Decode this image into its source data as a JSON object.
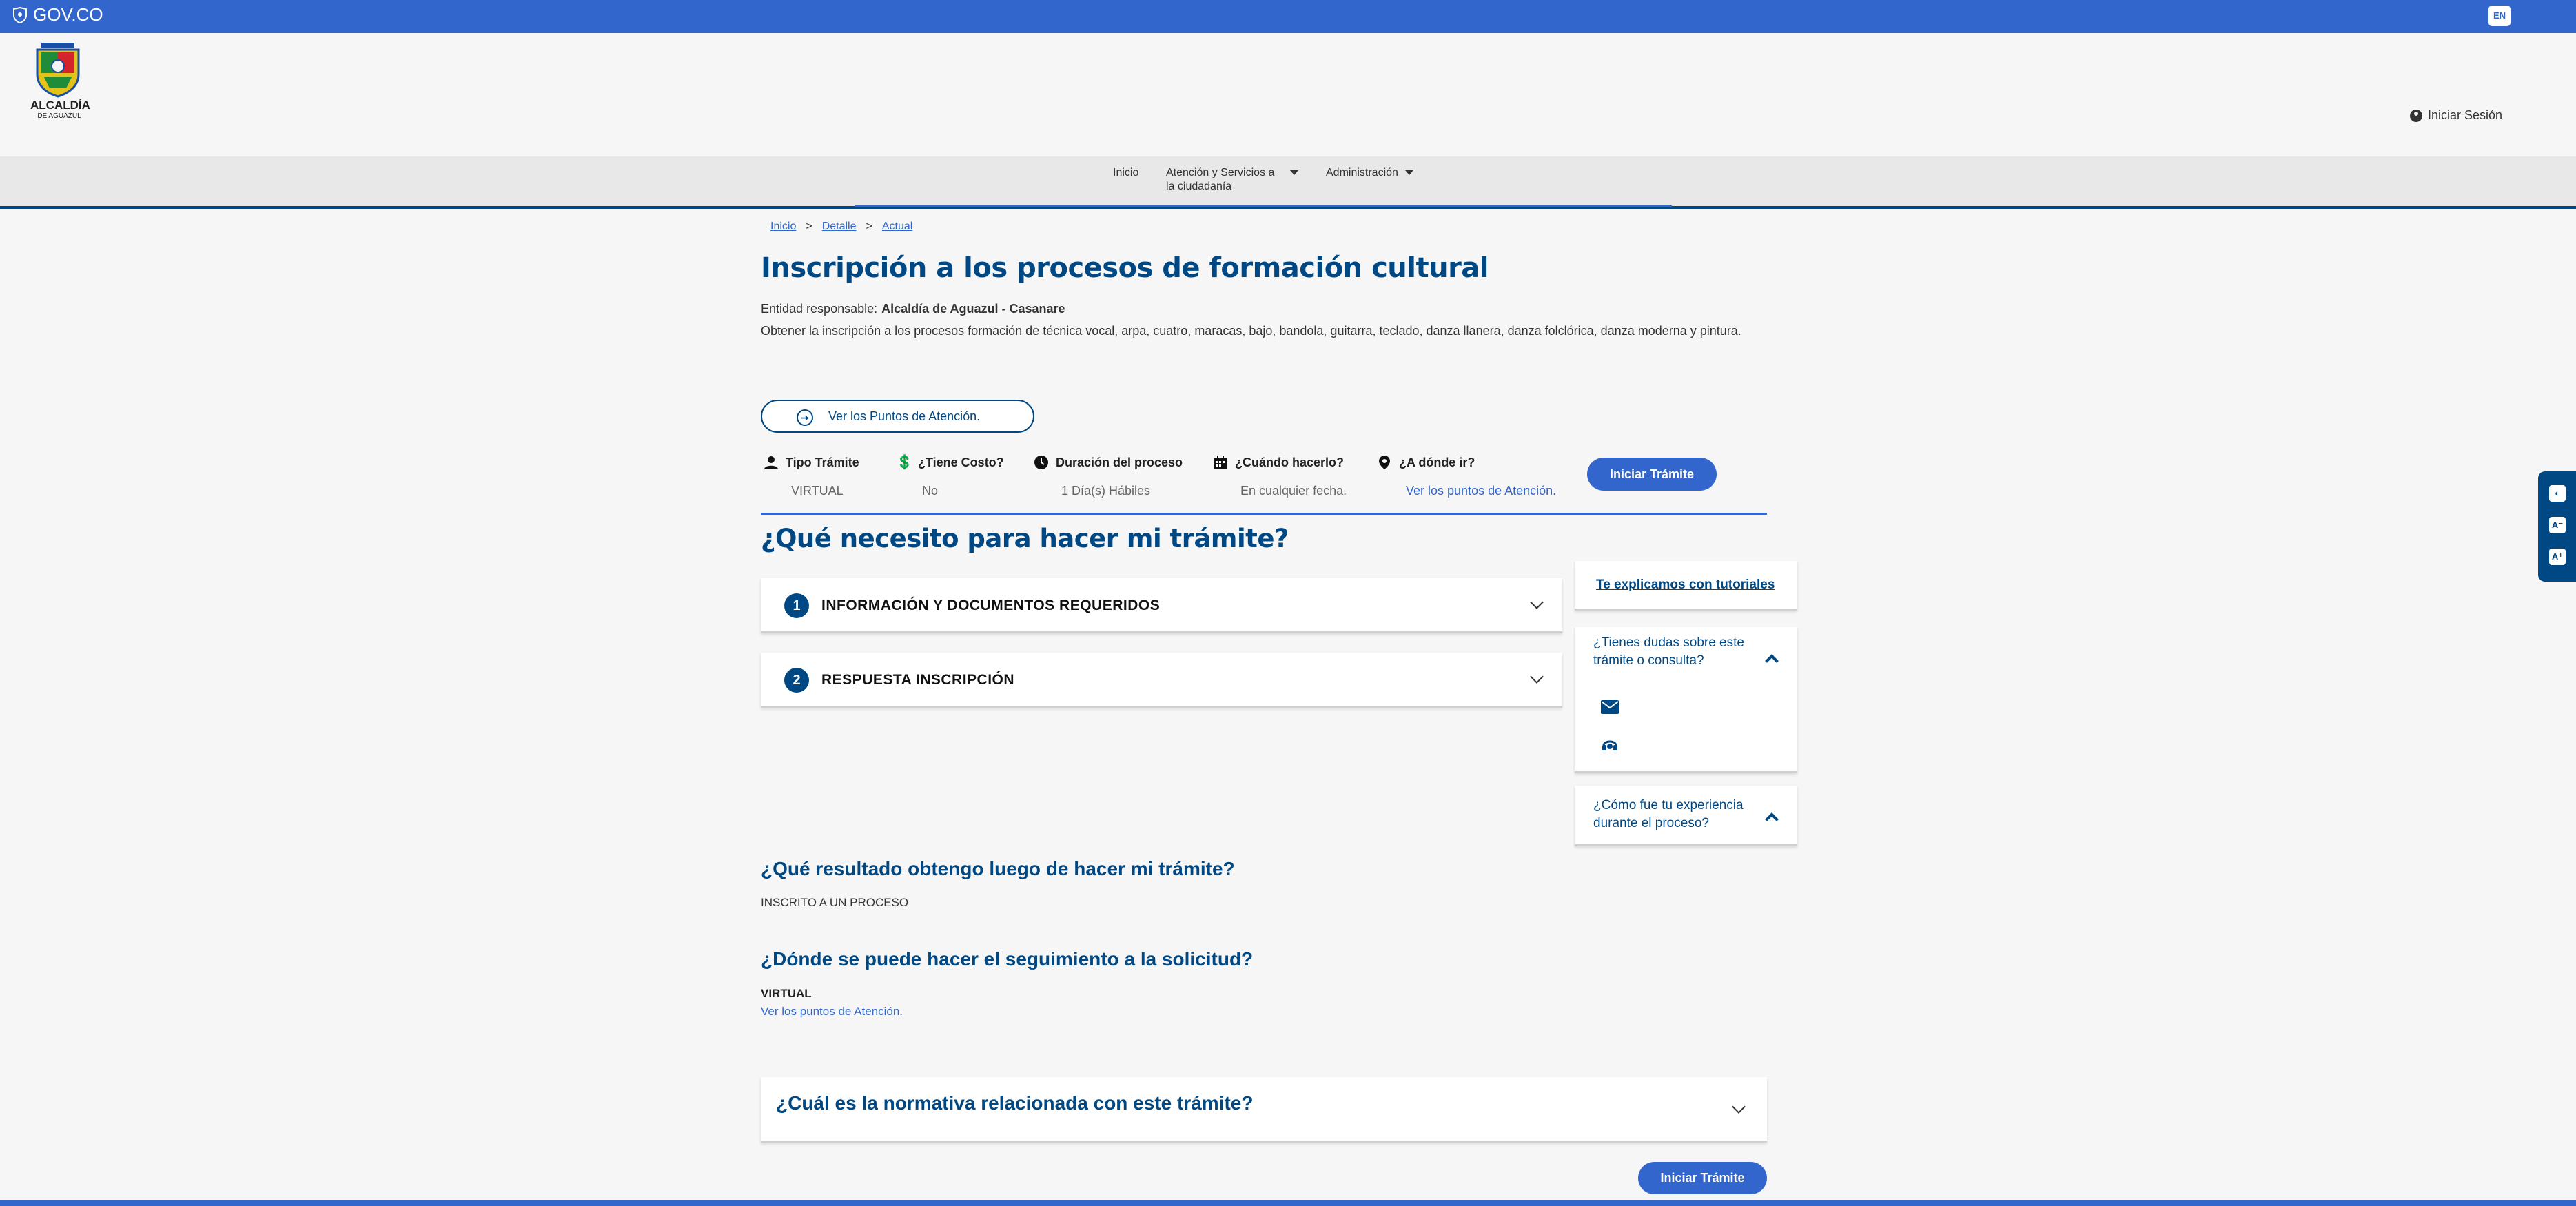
{
  "govbar": {
    "brand": "GOV.CO",
    "lang": "EN"
  },
  "header": {
    "org_name": "ALCALDÍA",
    "org_sub": "DE AGUAZUL",
    "login": "Iniciar Sesión"
  },
  "nav": {
    "items": [
      {
        "label": "Inicio"
      },
      {
        "label": "Atención y Servicios a",
        "label2": "la ciudadanía"
      },
      {
        "label": "Administración"
      }
    ]
  },
  "breadcrumb": {
    "items": [
      "Inicio",
      "Detalle",
      "Actual"
    ],
    "sep": ">"
  },
  "page": {
    "title": "Inscripción a los procesos de formación cultural",
    "entity_label": "Entidad responsable:",
    "entity_value": "Alcaldía de Aguazul - Casanare",
    "description": "Obtener la inscripción a los procesos formación de técnica vocal, arpa, cuatro, maracas, bajo, bandola, guitarra, teclado, danza llanera, danza folclórica, danza moderna y pintura.",
    "points_button": "Ver los Puntos de Atención."
  },
  "info": {
    "tipo": {
      "label": "Tipo Trámite",
      "value": "VIRTUAL",
      "icon": "person-icon"
    },
    "costo": {
      "label": "¿Tiene Costo?",
      "value": "No",
      "icon": "cost-icon"
    },
    "duracion": {
      "label": "Duración del proceso",
      "value": "1 Día(s) Hábiles",
      "icon": "clock-icon"
    },
    "cuando": {
      "label": "¿Cuándo hacerlo?",
      "value": "En cualquier fecha.",
      "icon": "calendar-icon"
    },
    "donde": {
      "label": "¿A dónde ir?",
      "value": "Ver los puntos de Atención.",
      "icon": "location-icon"
    },
    "start_button": "Iniciar Trámite"
  },
  "need": {
    "title": "¿Qué necesito para hacer mi trámite?",
    "steps": [
      {
        "num": "1",
        "label": "INFORMACIÓN Y DOCUMENTOS REQUERIDOS"
      },
      {
        "num": "2",
        "label": "RESPUESTA INSCRIPCIÓN"
      }
    ]
  },
  "sidebar": {
    "tutorials": "Te explicamos con tutoriales",
    "doubts_line1": "¿Tienes dudas sobre este",
    "doubts_line2": "trámite o consulta?",
    "experience_line1": "¿Cómo fue tu experiencia",
    "experience_line2": "durante el proceso?"
  },
  "result": {
    "title": "¿Qué resultado obtengo luego de hacer mi trámite?",
    "value": "INSCRITO A UN PROCESO"
  },
  "tracking": {
    "title": "¿Dónde se puede hacer el seguimiento a la solicitud?",
    "value": "VIRTUAL",
    "link": "Ver los puntos de Atención."
  },
  "normativa": {
    "title": "¿Cuál es la normativa relacionada con este trámite?"
  },
  "bottom_button": "Iniciar Trámite",
  "colors": {
    "gov_blue": "#3366cc",
    "dark_blue": "#004884",
    "background": "#f6f6f6"
  }
}
